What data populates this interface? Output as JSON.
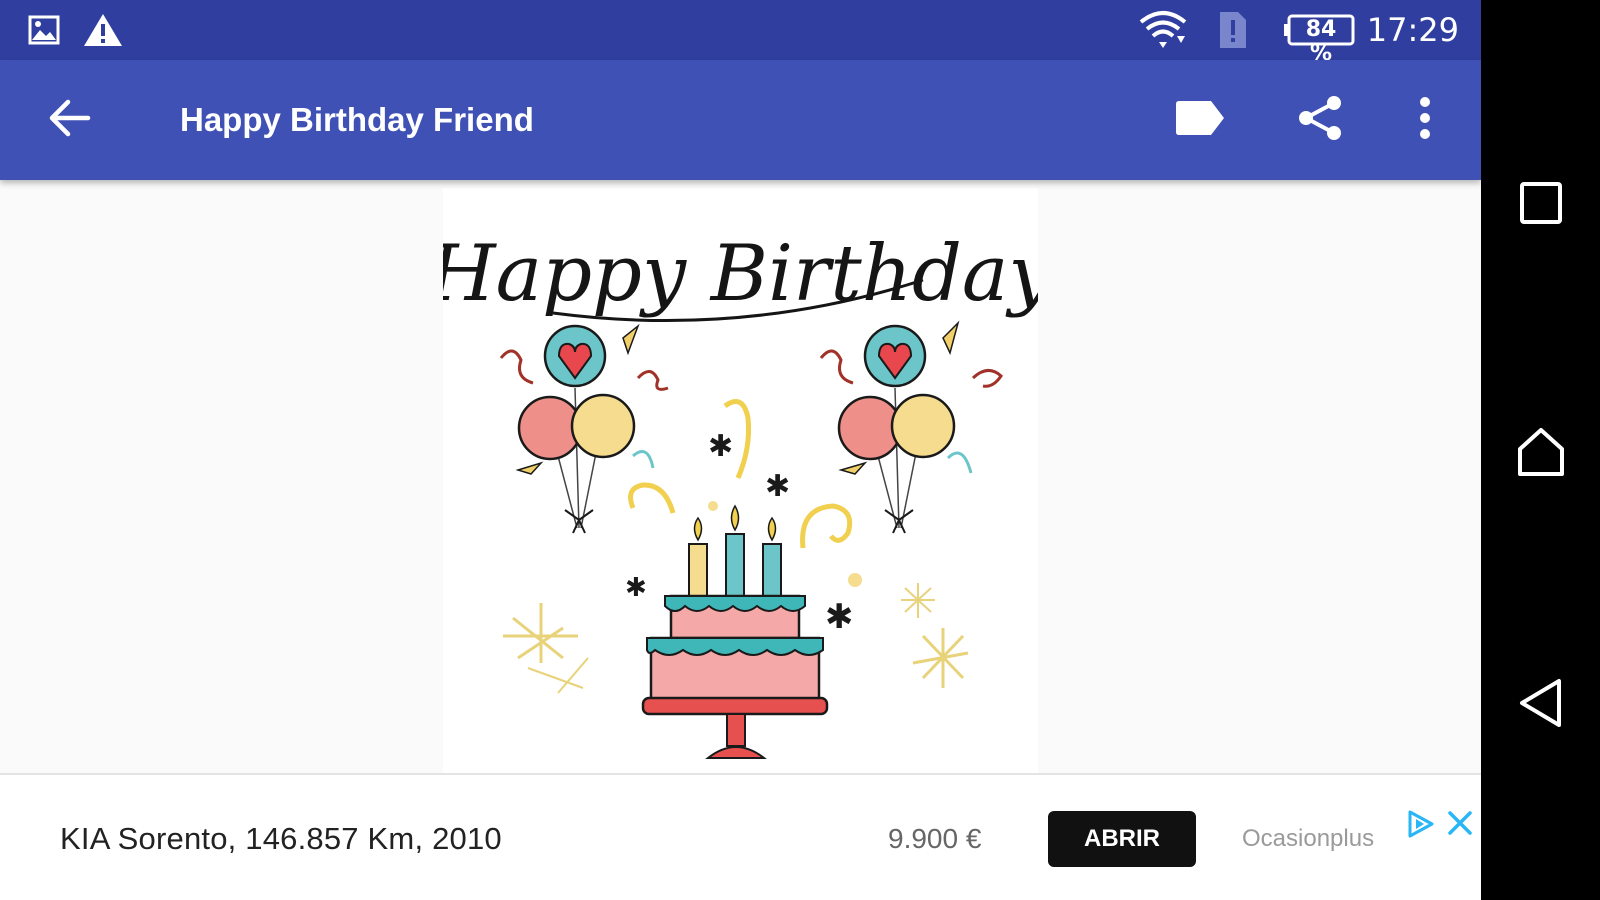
{
  "status_bar": {
    "left_icons": [
      "image-icon",
      "warning-icon"
    ],
    "right_icons": [
      "wifi-icon",
      "sim-alert-icon",
      "battery-icon"
    ],
    "battery": "84 %",
    "time": "17:29"
  },
  "app_bar": {
    "title": "Happy Birthday Friend",
    "icons": [
      "back-arrow-icon",
      "label-icon",
      "share-icon",
      "more-vert-icon"
    ]
  },
  "card": {
    "image_title": "Happy Birthday"
  },
  "ad": {
    "headline": "KIA Sorento, 146.857 Km, 2010",
    "price": "9.900 €",
    "cta": "ABRIR",
    "advertiser": "Ocasionplus",
    "icons": [
      "adchoices-icon",
      "close-icon"
    ]
  },
  "nav_bar": {
    "icons": [
      "recents-square-icon",
      "home-icon",
      "back-triangle-icon"
    ]
  },
  "colors": {
    "status_bar": "#303f9f",
    "app_bar": "#3f51b5",
    "background": "#fafafa",
    "ad_cta_bg": "#111111"
  }
}
